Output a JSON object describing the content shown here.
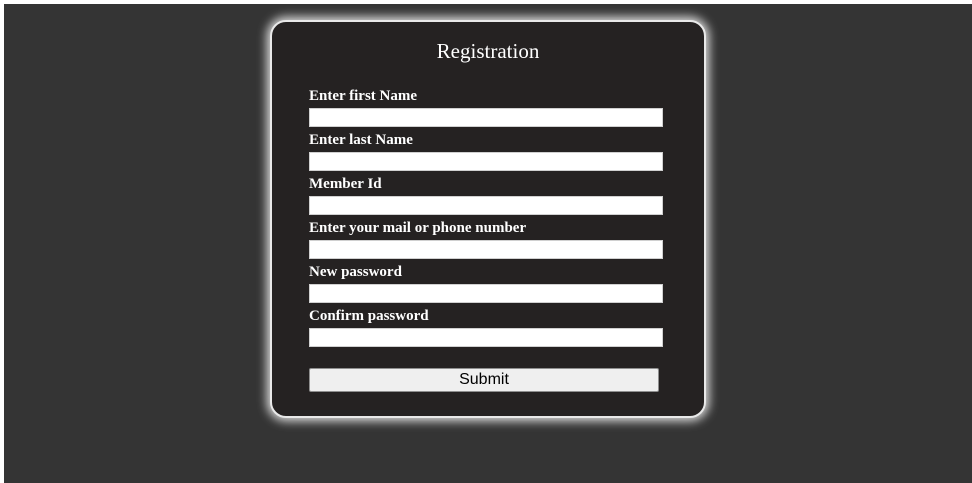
{
  "form": {
    "title": "Registration",
    "fields": [
      {
        "label": "Enter first Name",
        "value": "",
        "placeholder": ""
      },
      {
        "label": "Enter last Name",
        "value": "",
        "placeholder": ""
      },
      {
        "label": "Member Id",
        "value": "",
        "placeholder": ""
      },
      {
        "label": "Enter your mail or phone number",
        "value": "",
        "placeholder": ""
      },
      {
        "label": "New password",
        "value": "",
        "placeholder": ""
      },
      {
        "label": "Confirm password",
        "value": "",
        "placeholder": ""
      }
    ],
    "submit_label": "Submit"
  },
  "colors": {
    "page_background": "#343434",
    "card_background": "#252222",
    "card_border": "#e9e9e9",
    "text": "#ffffff",
    "input_background": "#ffffff",
    "button_background": "#efefef"
  }
}
